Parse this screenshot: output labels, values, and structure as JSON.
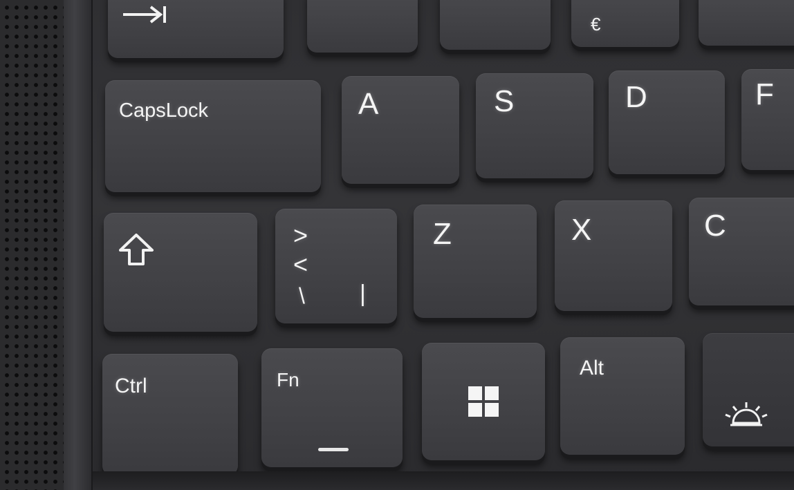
{
  "keyboard": {
    "row_top": {
      "tab_icon": "tab-arrow-icon",
      "euro_symbol": "€"
    },
    "row_home": {
      "capslock": "CapsLock",
      "a": "A",
      "s": "S",
      "d": "D",
      "f": "F"
    },
    "row_shift": {
      "shift_icon": "shift-arrow-icon",
      "angle_key": {
        "top": ">",
        "mid": "<",
        "left": "\\",
        "right": "|"
      },
      "z": "Z",
      "x": "X",
      "c": "C"
    },
    "row_bottom": {
      "ctrl": "Ctrl",
      "fn": "Fn",
      "win_icon": "windows-logo-icon",
      "alt": "Alt",
      "backlight_icon": "keyboard-backlight-icon"
    }
  }
}
